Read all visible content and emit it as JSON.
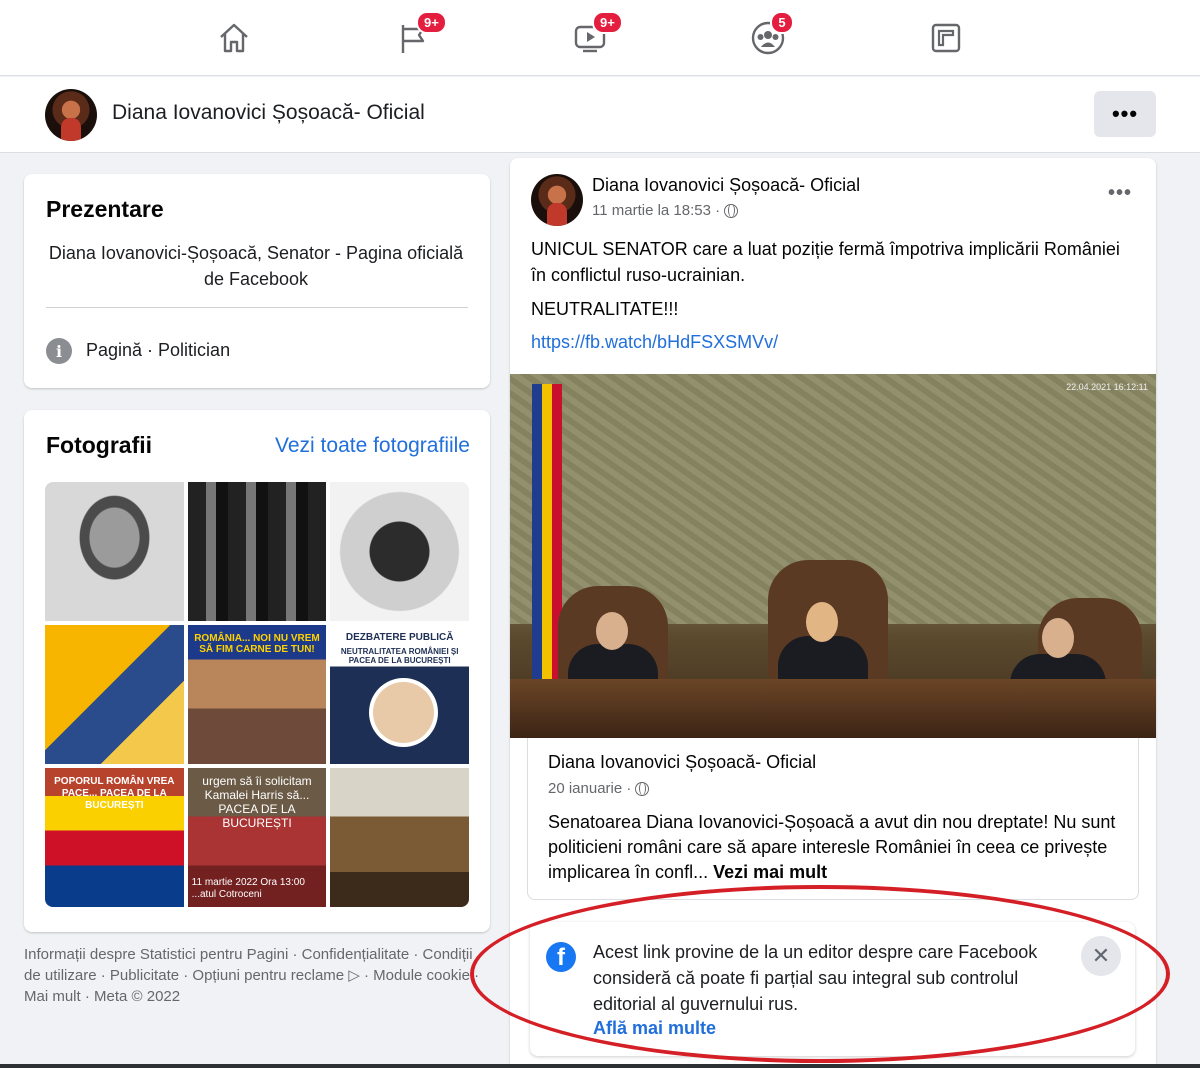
{
  "topnav": {
    "items": [
      {
        "name": "home-icon",
        "badge": ""
      },
      {
        "name": "pages-flag-icon",
        "badge": "9+"
      },
      {
        "name": "watch-video-icon",
        "badge": "9+"
      },
      {
        "name": "groups-icon",
        "badge": "5"
      },
      {
        "name": "gaming-icon",
        "badge": ""
      }
    ]
  },
  "page_header": {
    "name": "Diana Iovanovici Șoșoacă- Oficial",
    "more_label": "•••"
  },
  "intro": {
    "title": "Prezentare",
    "description": "Diana Iovanovici-Șoșoacă, Senator - Pagina oficială de Facebook",
    "category": "Pagină · Politician"
  },
  "photos": {
    "title": "Fotografii",
    "see_all": "Vezi toate fotografiile",
    "tile_texts": {
      "p5": "ROMÂNIA... NOI NU VREM SĂ FIM CARNE DE TUN!",
      "p6_top": "DEZBATERE PUBLICĂ",
      "p6_sub": "NEUTRALITATEA ROMÂNIEI ȘI PACEA DE LA BUCUREȘTI",
      "p7": "POPORUL ROMÂN VREA PACE... PACEA DE LA BUCUREȘTI",
      "p8": "urgem să îi solicitam Kamalei Harris să... PACEA DE LA BUCUREȘTI",
      "p8_date": "11 martie 2022 Ora 13:00 ...atul Cotroceni"
    }
  },
  "footer": {
    "text": "Informații despre Statistici pentru Pagini · Confidențialitate · Condiții de utilizare · Publicitate · Opțiuni pentru reclame ▷ · Module cookie · Mai mult · Meta © 2022"
  },
  "post": {
    "author": "Diana Iovanovici Șoșoacă- Oficial",
    "time": "11 martie la 18:53 ·",
    "paragraph1": "UNICUL SENATOR care a luat poziție fermă împotriva implicării României în conflictul ruso-ucrainian.",
    "paragraph2": "NEUTRALITATE!!!",
    "link": "https://fb.watch/bHdFSXSMVv/",
    "video_stamp": "22.04.2021 16:12:11",
    "shared": {
      "author": "Diana Iovanovici Șoșoacă- Oficial",
      "date": "20 ianuarie ·",
      "body": "Senatoarea Diana Iovanovici-Șoșoacă a avut din nou dreptate! Nu sunt politicieni români care să apare interesle României în ceea ce privește implicarea în confl...",
      "more": "Vezi mai mult"
    }
  },
  "notice": {
    "text": "Acest link provine de la un editor despre care Facebook consideră că poate fi parțial sau integral sub controlul editorial al guvernului rus.",
    "learn_more": "Află mai multe",
    "close": "✕"
  },
  "colors": {
    "link_blue": "#216fdb",
    "badge_red": "#e41e3f",
    "annotation_red": "#d41f26",
    "facebook_blue": "#1877f2"
  }
}
